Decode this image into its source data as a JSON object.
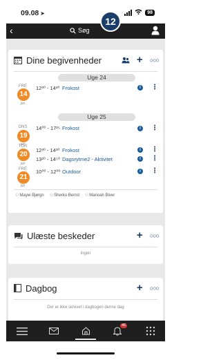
{
  "status_bar": {
    "time": "09.08",
    "battery": "98"
  },
  "top_bar": {
    "search_label": "Søg",
    "notification_count": "12"
  },
  "calendar": {
    "title": "Dine begivenheder",
    "weeks": [
      "Uge 24",
      "Uge 25"
    ],
    "days": [
      {
        "weekday": "FRE",
        "date": "14",
        "month": "jun"
      },
      {
        "weekday": "ONS",
        "date": "19",
        "month": "jun"
      },
      {
        "weekday": "TOR",
        "date": "20",
        "month": "jun"
      },
      {
        "weekday": "FRE",
        "date": "21",
        "month": "jun"
      }
    ],
    "events": [
      {
        "time": "12³⁰ - 14³⁰",
        "name": "Frokost"
      },
      {
        "time": "14⁰⁰ - 17²⁵",
        "name": "Frokost"
      },
      {
        "time": "12³⁰ - 14³⁰",
        "name": "Frokost"
      },
      {
        "time": "13²⁰ - 14⁵⁰",
        "name": "Dagsrytme2 - Aktivitet"
      },
      {
        "time": "10⁰⁰ - 12⁰⁰",
        "name": "Outdoor"
      }
    ],
    "people": [
      "Mayei Bjørgn",
      "Sherko Bernd",
      "Marioah Biver"
    ]
  },
  "messages": {
    "title": "Ulæste beskeder",
    "empty": "Ingen"
  },
  "diary": {
    "title": "Dagbog",
    "empty": "Der er ikke skrevet i dagbogen denne dag"
  },
  "bottom_nav": {
    "notifications_badge": "46"
  }
}
